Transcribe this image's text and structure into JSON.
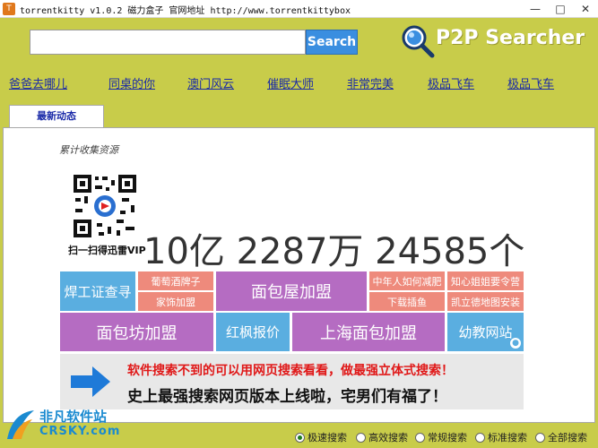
{
  "window": {
    "icon_glyph": "T",
    "title": "torrentkitty  v1.0.2 磁力盒子  官网地址 http://www.torrentkittybox",
    "min_glyph": "—",
    "max_glyph": "□",
    "close_glyph": "✕"
  },
  "search": {
    "value": "",
    "placeholder": "",
    "button_label": "Search"
  },
  "logo": {
    "text": "P2P Searcher"
  },
  "links": [
    "爸爸去哪儿",
    "同桌的你",
    "澳门风云",
    "催眠大师",
    "非常完美",
    "极品飞车",
    "极品飞车"
  ],
  "tabs": [
    {
      "label": "最新动态"
    }
  ],
  "stats": {
    "label": "累计收集资源",
    "qr_caption": "扫一扫得迅雷VIP",
    "total": "10亿 2287万 24585个"
  },
  "ads": {
    "welder": "焊工证查寻",
    "wine": "葡萄酒牌子",
    "home": "家饰加盟",
    "bread_house": "面包屋加盟",
    "middle_aged": "中年人如何减肥",
    "download": "下载插鱼",
    "bride": "知心姐姐要令营",
    "kaili": "凯立德地图安装",
    "bakery": "面包坊加盟",
    "redmaple": "红枫报价",
    "shanghai": "上海面包加盟",
    "kindergarten": "幼教网站"
  },
  "promo": {
    "line1": "软件搜索不到的可以用网页搜索看看，做最强立体式搜索！",
    "line2": "史上最强搜索网页版本上线啦，宅男们有福了！"
  },
  "watermark": {
    "cn": "非凡软件站",
    "en": "CRSKY.com"
  },
  "modes": [
    {
      "label": "极速搜索",
      "selected": true
    },
    {
      "label": "高效搜索",
      "selected": false
    },
    {
      "label": "常规搜索",
      "selected": false
    },
    {
      "label": "标准搜索",
      "selected": false
    },
    {
      "label": "全部搜索",
      "selected": false
    }
  ],
  "colors": {
    "background": "#c8cc4a",
    "accent_blue": "#5aaee0",
    "salmon": "#ee8a7c",
    "purple": "#b56cc2",
    "link": "#1a2aa8",
    "promo_red": "#e01818"
  }
}
